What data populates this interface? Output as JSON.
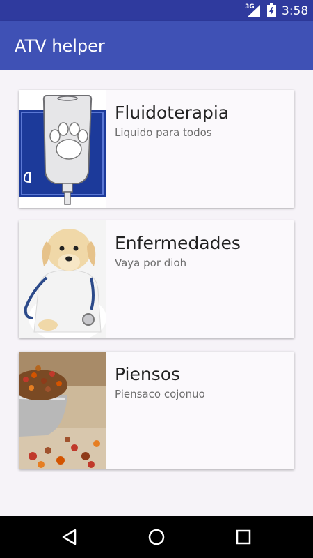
{
  "status_bar": {
    "network": "3G",
    "time": "3:58",
    "icons": [
      "signal-icon",
      "battery-icon"
    ]
  },
  "app_bar": {
    "title": "ATV helper"
  },
  "cards": [
    {
      "title": "Fluidoterapia",
      "subtitle": "Liquido para todos",
      "image": "iv-bag-paw-image"
    },
    {
      "title": "Enfermedades",
      "subtitle": "Vaya por dioh",
      "image": "puppy-stethoscope-image"
    },
    {
      "title": "Piensos",
      "subtitle": "Piensaco cojonuo",
      "image": "pet-food-bowl-image"
    }
  ],
  "nav_bar": {
    "buttons": [
      "back-icon",
      "home-icon",
      "recents-icon"
    ]
  },
  "colors": {
    "primary": "#3f51b5",
    "primary_dark": "#2f3a9e",
    "card_background": "#fbf9fc"
  }
}
